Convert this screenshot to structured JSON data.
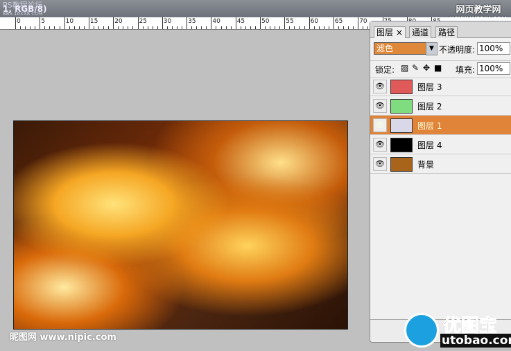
{
  "titlebar": {
    "title": "1, RGB/8)",
    "watermark": "PS教程论坛",
    "watermark_sub": "BBS.16XX8.COM",
    "site": "网页教学网",
    "site_sub": "WWW.WEBJX.COM"
  },
  "ruler": {
    "labels": [
      "0",
      "5",
      "10",
      "15",
      "20",
      "25",
      "30",
      "35",
      "40",
      "45",
      "50",
      "55",
      "60",
      "65",
      "70",
      "75",
      "80",
      "85"
    ]
  },
  "panel": {
    "tabs": [
      "图层 ×",
      "通道",
      "路径"
    ],
    "blend_mode": "滤色",
    "opacity_label": "不透明度:",
    "opacity": "100%",
    "lock_label": "锁定:",
    "fill_label": "填充:",
    "fill": "100%",
    "layers": [
      {
        "name": "图层 3",
        "thumb": "#e05a5a",
        "selected": false
      },
      {
        "name": "图层 2",
        "thumb": "#7fdc7f",
        "selected": false
      },
      {
        "name": "图层 1",
        "thumb": "#d8d8e8",
        "selected": true
      },
      {
        "name": "图层 4",
        "thumb": "#000000",
        "selected": false
      },
      {
        "name": "背景",
        "thumb": "#a8641a",
        "selected": false
      }
    ]
  },
  "credit": "昵图网 www.nipic.com",
  "logo": {
    "cn": "优图宝",
    "en": "utobao.com"
  },
  "colors": {
    "accent": "#e0843a"
  }
}
